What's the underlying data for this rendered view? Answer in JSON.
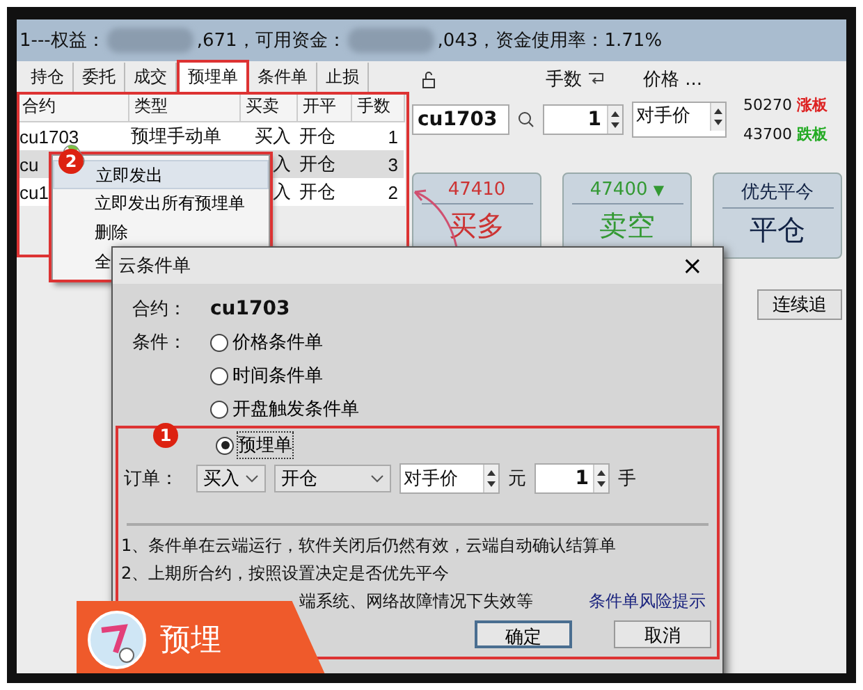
{
  "header": {
    "segments": [
      "1---权益：",
      ",671，可用资金：",
      ",043，资金使用率：1.71%"
    ]
  },
  "tabs": [
    {
      "label": "持仓",
      "selected": false
    },
    {
      "label": "委托",
      "selected": false
    },
    {
      "label": "成交",
      "selected": false
    },
    {
      "label": "预埋单",
      "selected": true
    },
    {
      "label": "条件单",
      "selected": false
    },
    {
      "label": "止损",
      "selected": false
    }
  ],
  "table": {
    "columns": [
      "合约",
      "类型",
      "买卖",
      "开平",
      "手数"
    ],
    "rows": [
      {
        "cells": [
          "cu1703",
          "预埋手动单",
          "买入",
          "开仓",
          "1"
        ],
        "selected": false
      },
      {
        "cells": [
          "cu",
          "",
          "入",
          "开仓",
          "3"
        ],
        "selected": true
      },
      {
        "cells": [
          "cu1",
          "",
          "入",
          "开仓",
          "2"
        ],
        "selected": false
      }
    ]
  },
  "order_panel": {
    "qty_label": "手数",
    "price_label": "价格 ...",
    "contract": "cu1703",
    "qty": "1",
    "price_type": "对手价",
    "limits": [
      {
        "kind": "up",
        "price": "50270",
        "label": "涨板"
      },
      {
        "kind": "down",
        "price": "43700",
        "label": "跌板"
      }
    ],
    "trade_buttons": [
      {
        "kind": "buy",
        "caption": "47410",
        "label": "买多"
      },
      {
        "kind": "sell",
        "caption": "47400",
        "marker": "▼",
        "label": "卖空"
      },
      {
        "kind": "close",
        "caption": "优先平今",
        "label": "平仓"
      }
    ],
    "bottom_button": "连续追"
  },
  "context_menu": {
    "items": [
      {
        "label": "立即发出",
        "selected": true
      },
      {
        "label": "立即发出所有预埋单",
        "selected": false
      },
      {
        "label": "删除",
        "selected": false
      },
      {
        "label": "全",
        "selected": false
      }
    ]
  },
  "dialog": {
    "title": "云条件单",
    "close": "×",
    "contract_label": "合约：",
    "contract": "cu1703",
    "condition_label": "条件：",
    "conditions": [
      {
        "label": "价格条件单",
        "selected": false
      },
      {
        "label": "时间条件单",
        "selected": false
      },
      {
        "label": "开盘触发条件单",
        "selected": false
      },
      {
        "label": "预埋单",
        "selected": true
      }
    ],
    "order_label": "订单：",
    "side": "买入",
    "action": "开仓",
    "price_type": "对手价",
    "price_unit": "元",
    "qty": "1",
    "qty_unit": "手",
    "notes": [
      "1、条件单在云端运行，软件关闭后仍然有效，云端自动确认结算单",
      "2、上期所合约，按照设置决定是否优先平今",
      "端系统、网络故障情况下失效等"
    ],
    "link": "条件单风险提示",
    "buttons": [
      "确定",
      "取消"
    ]
  },
  "badges": [
    "1",
    "2"
  ],
  "banner": {
    "label": "预埋"
  }
}
